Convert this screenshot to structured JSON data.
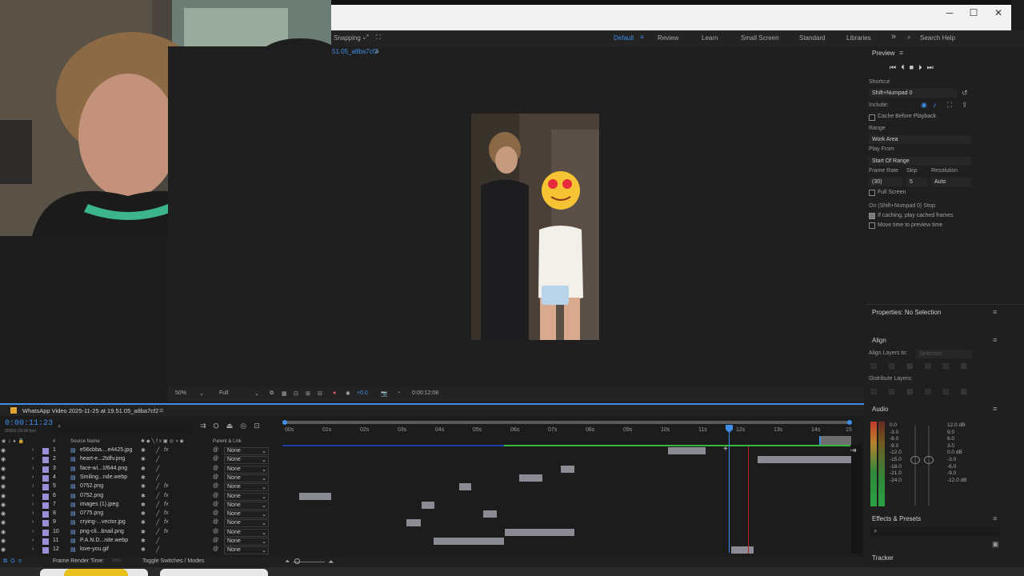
{
  "window": {
    "minimize": "─",
    "maximize": "☐",
    "close": "✕"
  },
  "workspace": {
    "snapping": "Snapping",
    "tabs": [
      "Default",
      "Review",
      "Learn",
      "Small Screen",
      "Standard",
      "Libraries"
    ],
    "more": "»",
    "search_placeholder": "Search Help"
  },
  "composition": {
    "tab": "51.05_a8ba7cf2",
    "zoom": "50%",
    "resolution": "Full",
    "exposure": "+0.0",
    "timecode": "0:00:12:08"
  },
  "preview": {
    "title": "Preview",
    "shortcut_label": "Shortcut",
    "shortcut_value": "Shift+Numpad 0",
    "include_label": "Include:",
    "cache_before": "Cache Before Playback",
    "range_label": "Range",
    "range_value": "Work Area",
    "play_from_label": "Play From",
    "play_from_value": "Start Of Range",
    "frame_rate_label": "Frame Rate",
    "skip_label": "Skip",
    "resolution_label": "Resolution",
    "frame_rate_value": "(30)",
    "skip_value": "5",
    "resolution_value": "Auto",
    "full_screen": "Full Screen",
    "on_stop": "On (Shift+Numpad 0) Stop:",
    "if_caching": "If caching, play cached frames",
    "move_time": "Move time to preview time"
  },
  "properties": {
    "title": "Properties: No Selection"
  },
  "align": {
    "title": "Align",
    "align_to": "Align Layers to:",
    "align_to_value": "Selection",
    "distribute": "Distribute Layers:"
  },
  "audio": {
    "title": "Audio",
    "left_scale": [
      "0.0",
      "-3.0",
      "-6.0",
      "-9.0",
      "-12.0",
      "-15.0",
      "-18.0",
      "-21.0",
      "-24.0"
    ],
    "right_scale": [
      "12.0 dB",
      "9.0",
      "6.0",
      "3.0",
      "0.0 dB",
      "-3.0",
      "-6.0",
      "-9.0",
      "-12.0 dB"
    ]
  },
  "effects": {
    "title": "Effects & Presets",
    "search_icon": "⌕"
  },
  "tracker": {
    "title": "Tracker"
  },
  "timeline": {
    "tab_title": "WhatsApp Video 2025-11-25 at 19.51.05_a8ba7cf2",
    "current_time": "0:00:11:23",
    "sub_time": "00353 (30.00 fps)",
    "col_hash": "#",
    "col_source": "Source Name",
    "col_parent": "Parent & Link",
    "ruler": [
      "00s",
      "01s",
      "02s",
      "03s",
      "04s",
      "05s",
      "06s",
      "07s",
      "08s",
      "09s",
      "10s",
      "11s",
      "12s",
      "13s",
      "14s",
      "15"
    ],
    "layers": [
      {
        "num": "1",
        "name": "e56cbba....e4425.jpg",
        "parent": "None",
        "fx": true
      },
      {
        "num": "2",
        "name": "heart-e...2tdfv.png",
        "parent": "None",
        "fx": false
      },
      {
        "num": "3",
        "name": "face-wi...1f644.png",
        "parent": "None",
        "fx": false
      },
      {
        "num": "4",
        "name": "Smiling...nde.webp",
        "parent": "None",
        "fx": false
      },
      {
        "num": "5",
        "name": "0752.png",
        "parent": "None",
        "fx": true
      },
      {
        "num": "6",
        "name": "0752.png",
        "parent": "None",
        "fx": true
      },
      {
        "num": "7",
        "name": "images (1).jpeg",
        "parent": "None",
        "fx": true
      },
      {
        "num": "8",
        "name": "0775.png",
        "parent": "None",
        "fx": true
      },
      {
        "num": "9",
        "name": "crying-...vector.jpg",
        "parent": "None",
        "fx": true
      },
      {
        "num": "10",
        "name": "png-cli...bnail.png",
        "parent": "None",
        "fx": true
      },
      {
        "num": "11",
        "name": "P.A.N.D...nite.webp",
        "parent": "None",
        "fx": false
      },
      {
        "num": "12",
        "name": "love-you.gif",
        "parent": "None",
        "fx": false
      }
    ],
    "footer_render": "Frame Render Time:",
    "footer_render_val": "2ms",
    "footer_toggle": "Toggle Switches / Modes"
  },
  "colors": {
    "accent": "#3e8ee8",
    "layer_label": "#9a8fd6",
    "bar": "#8b8b93",
    "playhead": "#3e8ee8"
  }
}
